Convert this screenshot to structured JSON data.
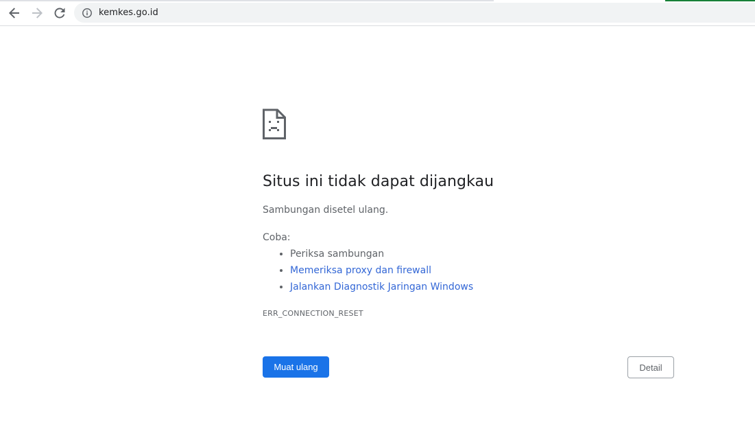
{
  "browser": {
    "url": "kemkes.go.id",
    "icons": {
      "back": "arrow-left-icon",
      "forward": "arrow-right-icon",
      "reload": "reload-icon",
      "site_info": "info-icon"
    }
  },
  "error_page": {
    "icon": "sad-document-icon",
    "title": "Situs ini tidak dapat dijangkau",
    "message": "Sambungan disetel ulang.",
    "try_label": "Coba:",
    "suggestions": [
      {
        "text": "Periksa sambungan",
        "is_link": false
      },
      {
        "text": "Memeriksa proxy dan firewall",
        "is_link": true
      },
      {
        "text": "Jalankan Diagnostik Jaringan Windows",
        "is_link": true
      }
    ],
    "error_code": "ERR_CONNECTION_RESET",
    "reload_label": "Muat ulang",
    "details_label": "Detail"
  },
  "colors": {
    "primary_button": "#1a73e8",
    "link": "#3367d6",
    "secondary_text": "#5f6368",
    "title_text": "#202124"
  }
}
